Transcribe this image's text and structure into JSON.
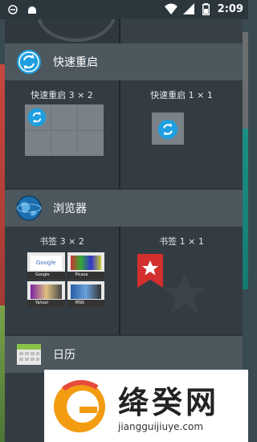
{
  "status_bar": {
    "time": "2:09",
    "left_icons": [
      "notification-icon",
      "android-icon"
    ],
    "right_icons": [
      "wifi-icon",
      "signal-icon",
      "battery-icon"
    ]
  },
  "sections": [
    {
      "title": "快速重启",
      "icon": "sync-icon",
      "tiles": [
        {
          "label": "快速重启 3 × 2"
        },
        {
          "label": "快速重启 1 × 1"
        }
      ]
    },
    {
      "title": "浏览器",
      "icon": "globe-icon",
      "tiles": [
        {
          "label": "书签 3 × 2",
          "thumbs": [
            "Google",
            "Picasa",
            "Yahoo!",
            "MSN"
          ]
        },
        {
          "label": "书签 1 × 1"
        }
      ]
    },
    {
      "title": "日历",
      "icon": "calendar-icon"
    }
  ],
  "watermark": {
    "title": "绛癸网",
    "url": "jiangguijiuye.com"
  },
  "colors": {
    "accent_sync": "#1e9fe0",
    "bookmark_red": "#d32f2f"
  }
}
